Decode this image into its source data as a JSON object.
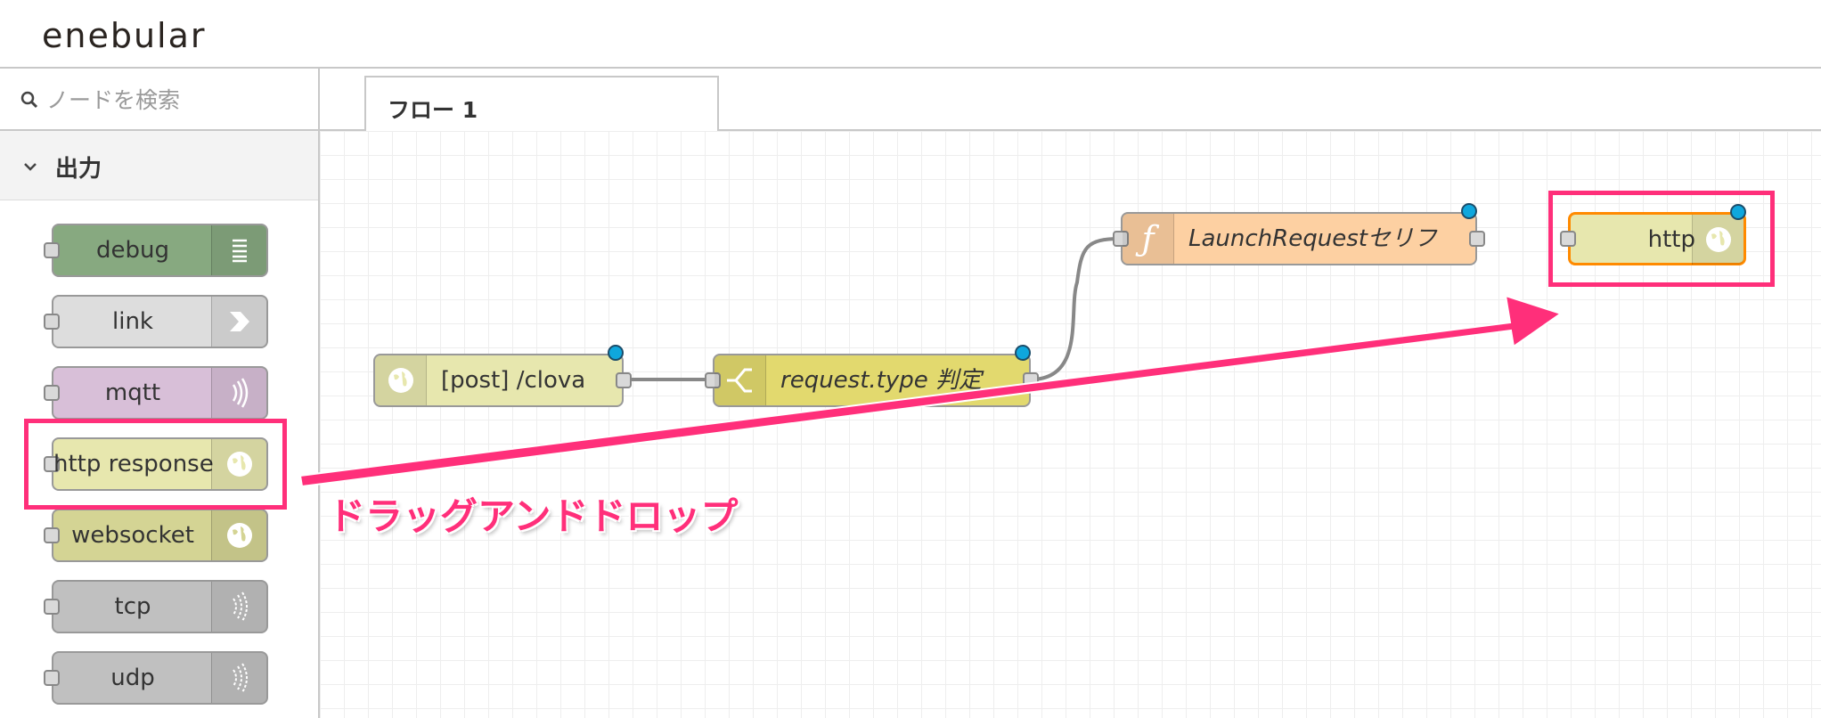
{
  "app": {
    "logo": "enebular"
  },
  "palette": {
    "search_placeholder": "ノードを検索",
    "category": "出力",
    "nodes": [
      {
        "label": "debug",
        "color": "#87a980"
      },
      {
        "label": "link",
        "color": "#dddddd"
      },
      {
        "label": "mqtt",
        "color": "#d8bfd8"
      },
      {
        "label": "http response",
        "color": "#e7e7ae"
      },
      {
        "label": "websocket",
        "color": "#d4d494"
      },
      {
        "label": "tcp",
        "color": "#c0c0c0"
      },
      {
        "label": "udp",
        "color": "#c0c0c0"
      }
    ]
  },
  "workspace": {
    "tab_label": "フロー 1",
    "nodes": {
      "http_in": "[post] /clova",
      "switch": "request.type 判定",
      "function": "LaunchRequestセリフ",
      "http_out": "http"
    }
  },
  "annotation": {
    "text": "ドラッグアンドドロップ",
    "color": "#ff2f7a"
  }
}
